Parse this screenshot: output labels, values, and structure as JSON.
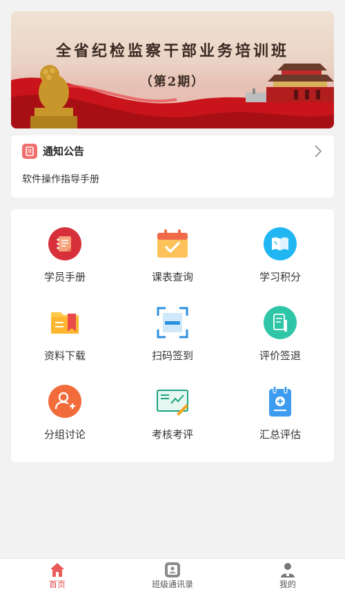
{
  "banner": {
    "title": "全省纪检监察干部业务培训班",
    "subtitle": "（第2期）"
  },
  "notice": {
    "title": "通知公告",
    "item": "软件操作指导手册"
  },
  "menu": [
    {
      "label": "学员手册",
      "icon": "handbook-icon"
    },
    {
      "label": "课表查询",
      "icon": "calendar-check-icon"
    },
    {
      "label": "学习积分",
      "icon": "book-icon"
    },
    {
      "label": "资料下载",
      "icon": "folder-icon"
    },
    {
      "label": "扫码签到",
      "icon": "scan-icon"
    },
    {
      "label": "评价签退",
      "icon": "evaluate-icon"
    },
    {
      "label": "分组讨论",
      "icon": "add-user-icon"
    },
    {
      "label": "考核考评",
      "icon": "assessment-icon"
    },
    {
      "label": "汇总评估",
      "icon": "clipboard-icon"
    }
  ],
  "tabs": [
    {
      "label": "首页",
      "icon": "home-icon",
      "active": true
    },
    {
      "label": "班级通讯录",
      "icon": "contacts-icon",
      "active": false
    },
    {
      "label": "我的",
      "icon": "user-icon",
      "active": false
    }
  ],
  "colors": {
    "accent": "#e04b4b",
    "background": "#f2f2f2"
  }
}
